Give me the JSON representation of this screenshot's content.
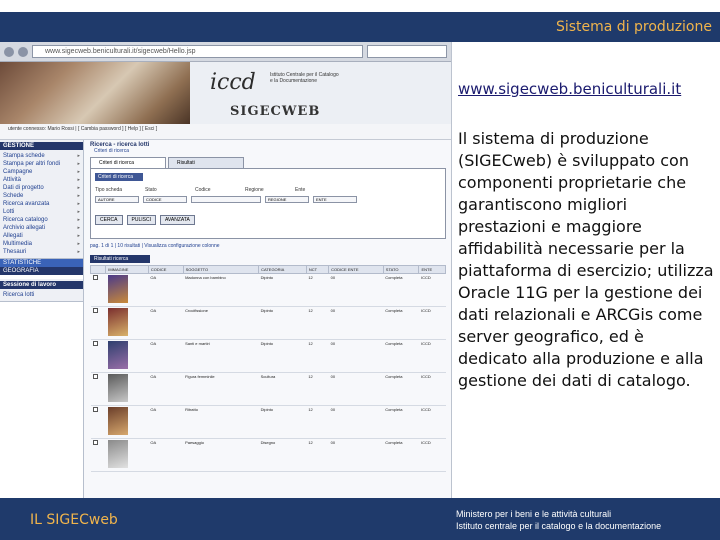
{
  "header": {
    "title": "Sistema di produzione"
  },
  "link": {
    "url": "www.sigecweb.beniculturali.it"
  },
  "description": "Il sistema di produzione (SIGECweb) è sviluppato con componenti proprietarie che garantiscono migliori prestazioni e maggiore affidabilità necessarie per la piattaforma di esercizio; utilizza Oracle 11G per la gestione dei dati relazionali e ARCGis come server geografico, ed è dedicato alla produzione e alla gestione dei dati di catalogo.",
  "footer": {
    "title": "IL SIGECweb",
    "ministry_line1": "Ministero per i beni e le attività culturali",
    "ministry_line2": "Istituto centrale per il catalogo e la documentazione"
  },
  "screenshot": {
    "browser_url": "www.sigecweb.beniculturali.it/sigecweb/Hello.jsp",
    "logo_text": "iccd",
    "institute_text": "Istituto Centrale per il Catalogo e la Documentazione",
    "app_name": "SIGECWEB",
    "user_strip": "utente connesso: Mario Rossi | [ Cambia password ] [ Help ] [ Esci ]",
    "menu_heading": "GESTIONE",
    "menu_items": [
      "Stampa schede",
      "Stampa per altri fondi",
      "Campagne",
      "Attività",
      "Dati di progetto",
      "Schede",
      "Ricerca avanzata",
      "Lotti",
      "Ricerca catalogo",
      "Archivio allegati",
      "Allegati",
      "Multimedia",
      "Thesauri"
    ],
    "menu_footer_1": "STATISTICHE",
    "menu_footer_2": "GEOGRAFIA",
    "work_area_heading": "Sessione di lavoro",
    "work_area_item": "Ricerca lotti",
    "breadcrumb": "Ricerca - ricerca lotti",
    "breadcrumb_sub": "Criteri di ricerca",
    "tab_1": "Criteri di ricerca",
    "tab_2": "Risultati",
    "subhead": "Criteri di ricerca",
    "filter_labels": [
      "Tipo scheda",
      "Stato",
      "Codice",
      "Regione",
      "Ente"
    ],
    "field_values": [
      "AUTORE",
      "CODICE",
      "REGIONE",
      "ENTE"
    ],
    "buttons": [
      "CERCA",
      "PULISCI",
      "AVANZATA"
    ],
    "pager": "pag. 1 di 1 | 10 risultati | Visualizza configurazione colonne",
    "grid_title": "Risultati ricerca",
    "columns": [
      "",
      "IMMAGINE",
      "CODICE",
      "SOGGETTO",
      "CATEGORIA",
      "NCT",
      "CODICE ENTE",
      "STATO",
      "ENTE"
    ],
    "rows": [
      [
        "",
        "",
        "OA",
        "Madonna con bambino",
        "Dipinto",
        "12",
        "00",
        "Completa",
        "ICCD"
      ],
      [
        "",
        "",
        "OA",
        "Crocifissione",
        "Dipinto",
        "12",
        "00",
        "Completa",
        "ICCD"
      ],
      [
        "",
        "",
        "OA",
        "Santi e martiri",
        "Dipinto",
        "12",
        "00",
        "Completa",
        "ICCD"
      ],
      [
        "",
        "",
        "OA",
        "Figura femminile",
        "Scultura",
        "12",
        "00",
        "Completa",
        "ICCD"
      ],
      [
        "",
        "",
        "OA",
        "Ritratto",
        "Dipinto",
        "12",
        "00",
        "Completa",
        "ICCD"
      ],
      [
        "",
        "",
        "OA",
        "Paesaggio",
        "Disegno",
        "12",
        "00",
        "Completa",
        "ICCD"
      ]
    ]
  },
  "colors": {
    "banner": "#1f3a6b",
    "banner_text": "#f0b44c",
    "link": "#1a1a6e"
  }
}
